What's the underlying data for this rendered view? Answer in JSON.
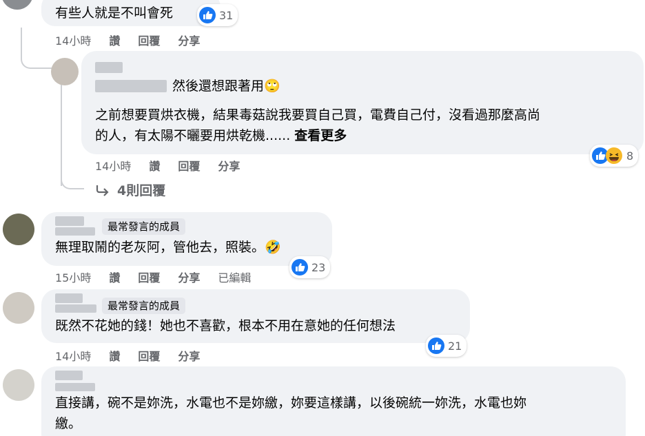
{
  "comments": [
    {
      "text": "有些人就是不叫會死",
      "like_count": "31",
      "time": "14小時",
      "like_label": "讚",
      "reply_label": "回覆",
      "share_label": "分享"
    },
    {
      "mention_text": "然後還想跟著用",
      "emoji": "🙄",
      "body_line1": "之前想要買烘衣機，結果毒菇說我要買自己買，電費自己付，沒看過那麼高尚",
      "body_line2": "的人，有太陽不曬要用烘乾機......",
      "see_more": "查看更多",
      "reaction_count": "8",
      "time": "14小時",
      "like_label": "讚",
      "reply_label": "回覆",
      "share_label": "分享",
      "replies_link": "4則回覆"
    },
    {
      "badge": "最常發言的成員",
      "text": "無理取鬧的老灰阿，管他去，照裝。",
      "emoji": "🤣",
      "like_count": "23",
      "time": "15小時",
      "like_label": "讚",
      "reply_label": "回覆",
      "share_label": "分享",
      "edited_label": "已編輯"
    },
    {
      "badge": "最常發言的成員",
      "text": "既然不花她的錢！她也不喜歡，根本不用在意她的任何想法",
      "like_count": "21",
      "time": "14小時",
      "like_label": "讚",
      "reply_label": "回覆",
      "share_label": "分享"
    },
    {
      "body_line1": "直接講，碗不是妳洗，水電也不是妳繳，妳要這樣講，以後碗統一妳洗，水電也妳",
      "body_line2": "繳。"
    }
  ],
  "icons": [
    "like-icon",
    "haha-icon",
    "reply-arrow-icon"
  ],
  "colors": {
    "like_blue": "#1877f2",
    "bubble_bg": "#f0f2f5",
    "meta_gray": "#65676b",
    "haha_yellow": "#f7b928"
  }
}
